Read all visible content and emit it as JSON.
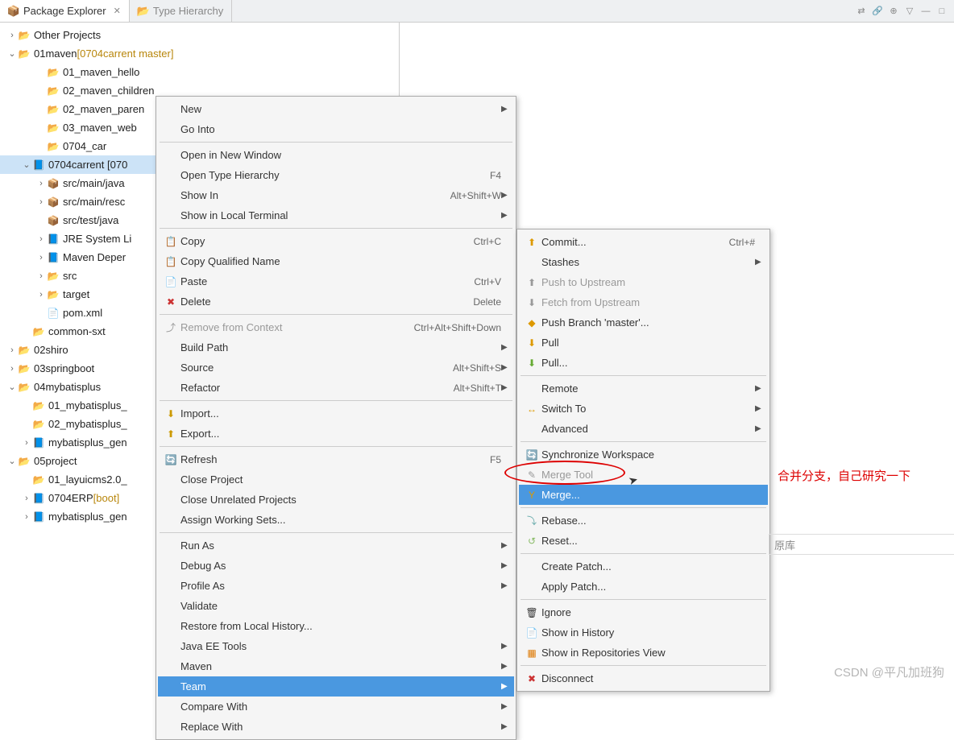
{
  "tabs": {
    "package_explorer": "Package Explorer",
    "type_hierarchy": "Type Hierarchy"
  },
  "tree": [
    {
      "caret": ">",
      "icon": "folder",
      "label": "Other Projects",
      "indent": 0
    },
    {
      "caret": "v",
      "icon": "proj",
      "label": "01maven",
      "decor": "[0704carrent master]",
      "indent": 0
    },
    {
      "caret": "",
      "icon": "folder",
      "label": "01_maven_hello",
      "indent": 2
    },
    {
      "caret": "",
      "icon": "folder",
      "label": "02_maven_children",
      "indent": 2
    },
    {
      "caret": "",
      "icon": "folder",
      "label": "02_maven_paren",
      "indent": 2
    },
    {
      "caret": "",
      "icon": "folder",
      "label": "03_maven_web",
      "indent": 2
    },
    {
      "caret": "",
      "icon": "folder",
      "label": "0704_car",
      "indent": 2
    },
    {
      "caret": "v",
      "icon": "java",
      "label": "0704carrent [070",
      "indent": 1,
      "selected": true
    },
    {
      "caret": ">",
      "icon": "pkg",
      "label": "src/main/java",
      "indent": 2
    },
    {
      "caret": ">",
      "icon": "pkg",
      "label": "src/main/resc",
      "indent": 2
    },
    {
      "caret": "",
      "icon": "pkg",
      "label": "src/test/java",
      "indent": 2
    },
    {
      "caret": ">",
      "icon": "java",
      "label": "JRE System Li",
      "indent": 2
    },
    {
      "caret": ">",
      "icon": "java",
      "label": "Maven Deper",
      "indent": 2
    },
    {
      "caret": ">",
      "icon": "folder",
      "label": "src",
      "indent": 2
    },
    {
      "caret": ">",
      "icon": "folder",
      "label": "target",
      "indent": 2
    },
    {
      "caret": "",
      "icon": "file",
      "label": "pom.xml",
      "indent": 2
    },
    {
      "caret": "",
      "icon": "folder",
      "label": "common-sxt",
      "indent": 1
    },
    {
      "caret": ">",
      "icon": "proj",
      "label": "02shiro",
      "indent": 0
    },
    {
      "caret": ">",
      "icon": "proj",
      "label": "03springboot",
      "indent": 0
    },
    {
      "caret": "v",
      "icon": "proj",
      "label": "04mybatisplus",
      "indent": 0
    },
    {
      "caret": "",
      "icon": "folder",
      "label": "01_mybatisplus_",
      "indent": 1
    },
    {
      "caret": "",
      "icon": "folder",
      "label": "02_mybatisplus_",
      "indent": 1
    },
    {
      "caret": ">",
      "icon": "java",
      "label": "mybatisplus_gen",
      "indent": 1
    },
    {
      "caret": "v",
      "icon": "proj",
      "label": "05project",
      "indent": 0
    },
    {
      "caret": "",
      "icon": "folder",
      "label": "01_layuicms2.0_",
      "indent": 1
    },
    {
      "caret": ">",
      "icon": "java",
      "label": "0704ERP",
      "decor": "[boot]",
      "indent": 1
    },
    {
      "caret": ">",
      "icon": "java",
      "label": "mybatisplus_gen",
      "indent": 1
    }
  ],
  "menu1": [
    {
      "label": "New",
      "sub": true
    },
    {
      "label": "Go Into"
    },
    {
      "sep": true
    },
    {
      "label": "Open in New Window"
    },
    {
      "label": "Open Type Hierarchy",
      "shortcut": "F4"
    },
    {
      "label": "Show In",
      "shortcut": "Alt+Shift+W",
      "sub": true
    },
    {
      "label": "Show in Local Terminal",
      "sub": true
    },
    {
      "sep": true
    },
    {
      "icon": "📋",
      "label": "Copy",
      "shortcut": "Ctrl+C"
    },
    {
      "icon": "📋",
      "label": "Copy Qualified Name"
    },
    {
      "icon": "📄",
      "label": "Paste",
      "shortcut": "Ctrl+V"
    },
    {
      "icon": "✖",
      "iconColor": "#c33",
      "label": "Delete",
      "shortcut": "Delete"
    },
    {
      "sep": true
    },
    {
      "icon": "⤴",
      "label": "Remove from Context",
      "shortcut": "Ctrl+Alt+Shift+Down",
      "disabled": true
    },
    {
      "label": "Build Path",
      "sub": true
    },
    {
      "label": "Source",
      "shortcut": "Alt+Shift+S",
      "sub": true
    },
    {
      "label": "Refactor",
      "shortcut": "Alt+Shift+T",
      "sub": true
    },
    {
      "sep": true
    },
    {
      "icon": "⬇",
      "iconColor": "#c90",
      "label": "Import..."
    },
    {
      "icon": "⬆",
      "iconColor": "#c90",
      "label": "Export..."
    },
    {
      "sep": true
    },
    {
      "icon": "🔄",
      "iconColor": "#c90",
      "label": "Refresh",
      "shortcut": "F5"
    },
    {
      "label": "Close Project"
    },
    {
      "label": "Close Unrelated Projects"
    },
    {
      "label": "Assign Working Sets..."
    },
    {
      "sep": true
    },
    {
      "label": "Run As",
      "sub": true
    },
    {
      "label": "Debug As",
      "sub": true
    },
    {
      "label": "Profile As",
      "sub": true
    },
    {
      "label": "Validate"
    },
    {
      "label": "Restore from Local History..."
    },
    {
      "label": "Java EE Tools",
      "sub": true
    },
    {
      "label": "Maven",
      "sub": true
    },
    {
      "label": "Team",
      "sub": true,
      "highlighted": true
    },
    {
      "label": "Compare With",
      "sub": true
    },
    {
      "label": "Replace With",
      "sub": true
    }
  ],
  "menu2": [
    {
      "icon": "⬆",
      "iconColor": "#d90",
      "label": "Commit...",
      "shortcut": "Ctrl+#"
    },
    {
      "label": "Stashes",
      "sub": true
    },
    {
      "icon": "⬆",
      "label": "Push to Upstream",
      "disabled": true
    },
    {
      "icon": "⬇",
      "label": "Fetch from Upstream",
      "disabled": true
    },
    {
      "icon": "◆",
      "iconColor": "#d90",
      "label": "Push Branch 'master'..."
    },
    {
      "icon": "⬇",
      "iconColor": "#d90",
      "label": "Pull"
    },
    {
      "icon": "⬇",
      "iconColor": "#6a3",
      "label": "Pull..."
    },
    {
      "sep": true
    },
    {
      "label": "Remote",
      "sub": true
    },
    {
      "icon": "↔",
      "iconColor": "#d90",
      "label": "Switch To",
      "sub": true
    },
    {
      "label": "Advanced",
      "sub": true
    },
    {
      "sep": true
    },
    {
      "icon": "🔄",
      "iconColor": "#d90",
      "label": "Synchronize Workspace"
    },
    {
      "icon": "✎",
      "label": "Merge Tool",
      "disabled": true
    },
    {
      "icon": "Y",
      "iconColor": "#d90",
      "label": "Merge...",
      "highlighted": true
    },
    {
      "sep": true
    },
    {
      "icon": "⤵",
      "iconColor": "#6aa",
      "label": "Rebase..."
    },
    {
      "icon": "↺",
      "iconColor": "#8b6",
      "label": "Reset..."
    },
    {
      "sep": true
    },
    {
      "label": "Create Patch..."
    },
    {
      "label": "Apply Patch..."
    },
    {
      "sep": true
    },
    {
      "icon": "🗑",
      "label": "Ignore"
    },
    {
      "icon": "📄",
      "label": "Show in History"
    },
    {
      "icon": "▦",
      "iconColor": "#d70",
      "label": "Show in Repositories View"
    },
    {
      "sep": true
    },
    {
      "icon": "✖",
      "iconColor": "#c33",
      "label": "Disconnect"
    }
  ],
  "annotation": "合并分支，自己研究一下",
  "side_panel": "原库",
  "watermark": "CSDN @平凡加班狗"
}
